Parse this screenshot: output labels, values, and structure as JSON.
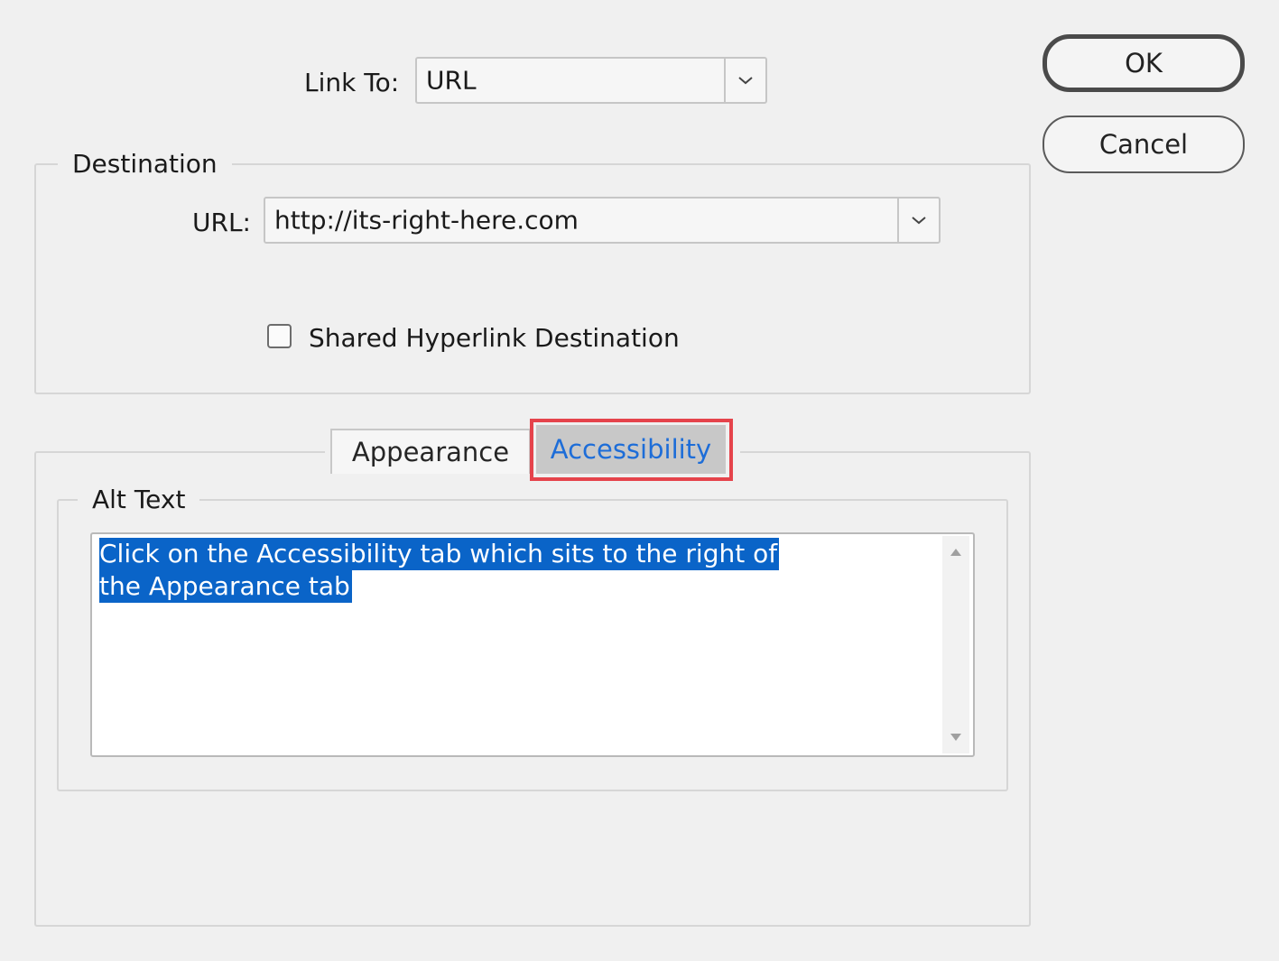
{
  "link_to": {
    "label": "Link To:",
    "selected_value": "URL"
  },
  "destination": {
    "legend": "Destination",
    "url_label": "URL:",
    "url_value": "http://its-right-here.com",
    "shared_checkbox_label": "Shared Hyperlink Destination",
    "shared_checked": false
  },
  "tabs": [
    {
      "label": "Appearance",
      "active": false
    },
    {
      "label": "Accessibility",
      "active": true
    }
  ],
  "alt_text": {
    "legend": "Alt Text",
    "lines": [
      "Click on the Accessibility tab which sits to the right of",
      "the Appearance tab"
    ]
  },
  "buttons": {
    "ok_label": "OK",
    "cancel_label": "Cancel"
  },
  "colors": {
    "highlight": "#e5434b",
    "active_tab_text": "#1d6dd8",
    "selection": "#0a64c8"
  }
}
